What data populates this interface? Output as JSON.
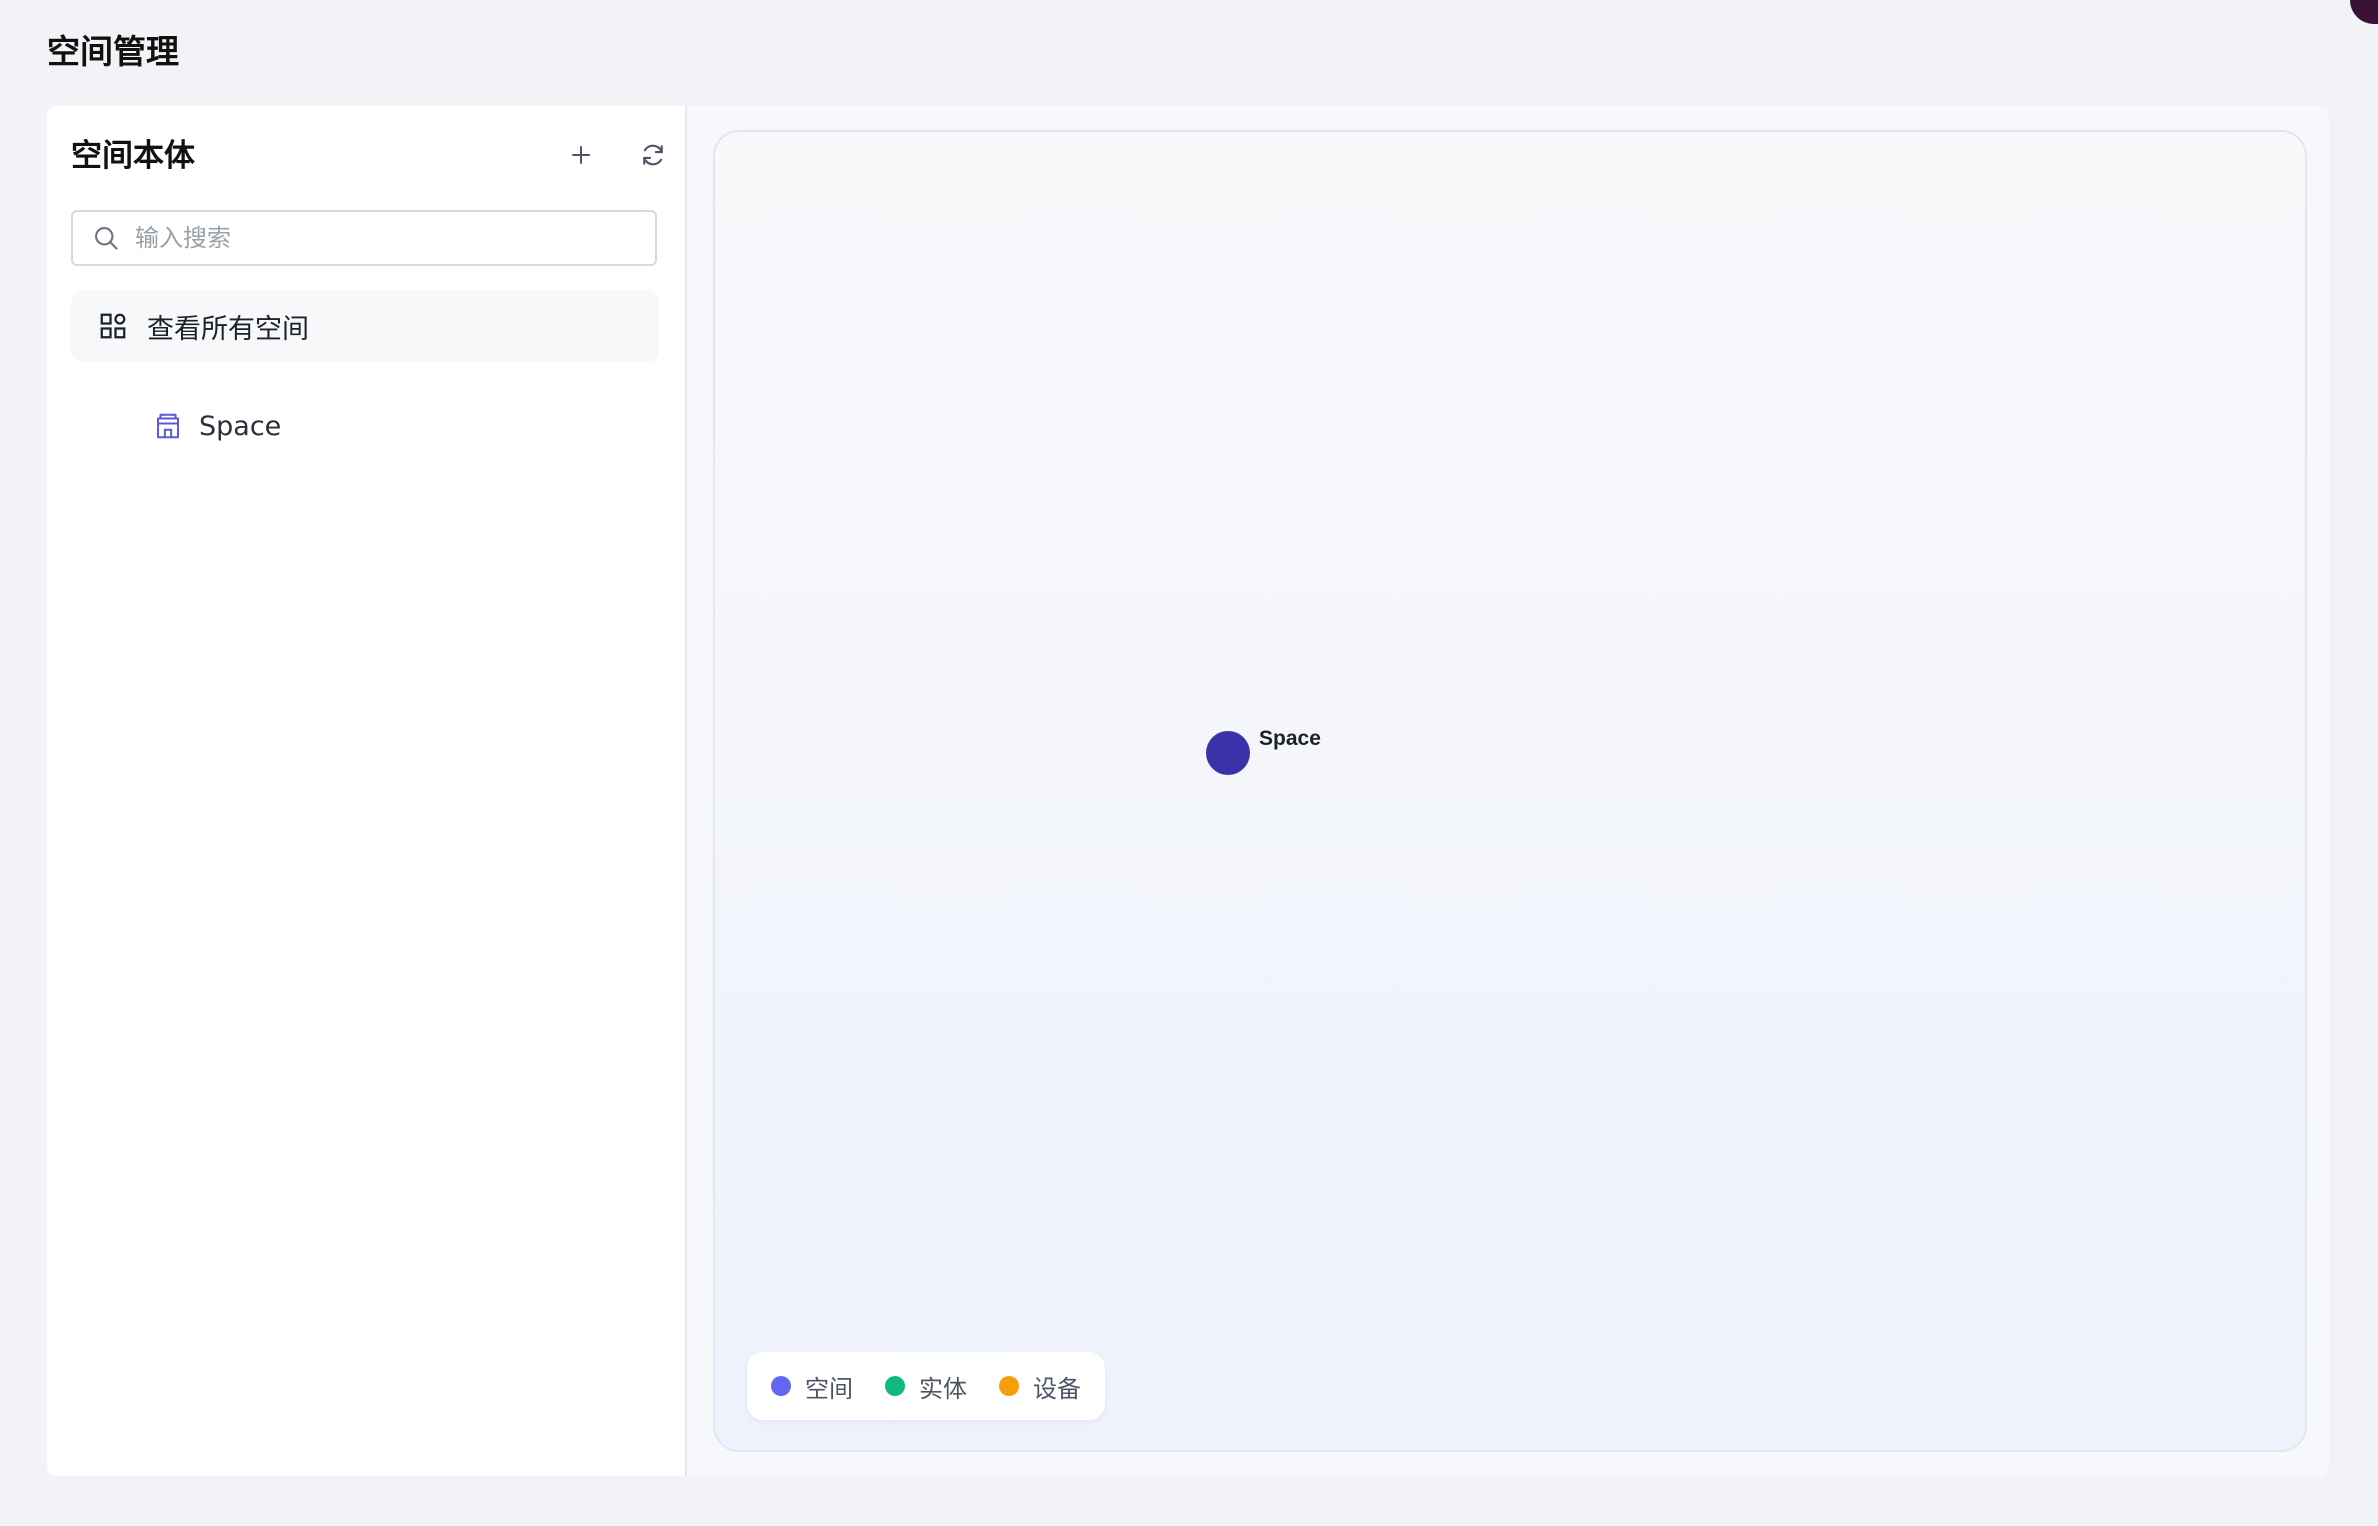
{
  "page": {
    "title": "空间管理"
  },
  "sidebar": {
    "title": "空间本体",
    "add_icon": "plus-icon",
    "refresh_icon": "refresh-icon",
    "search": {
      "placeholder": "输入搜索",
      "value": ""
    },
    "all_spaces_label": "查看所有空间",
    "tree": [
      {
        "label": "Space",
        "icon": "building-icon"
      }
    ]
  },
  "graph": {
    "nodes": [
      {
        "label": "Space",
        "type": "空间",
        "color": "#3b31a8"
      }
    ],
    "legend": [
      {
        "label": "空间",
        "color": "#6366f1"
      },
      {
        "label": "实体",
        "color": "#10b981"
      },
      {
        "label": "设备",
        "color": "#f59e0b"
      }
    ]
  },
  "colors": {
    "accent": "#6366f1",
    "node_space": "#3b31a8",
    "background": "#f2f3f6"
  }
}
